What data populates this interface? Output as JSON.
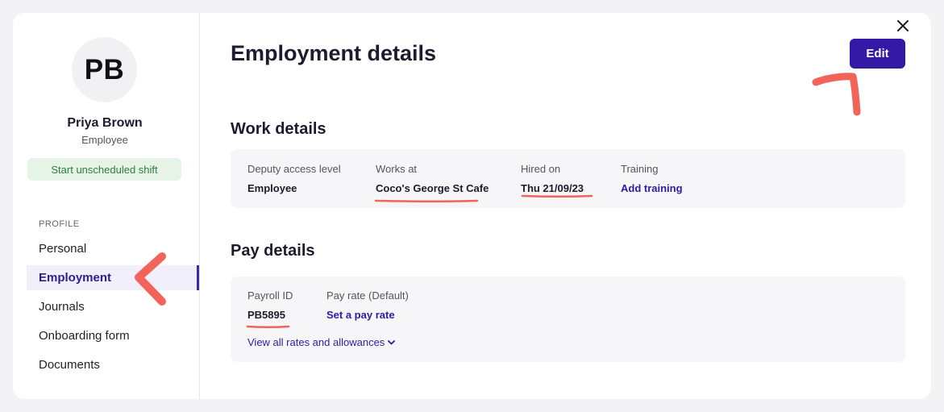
{
  "sidebar": {
    "avatar_initials": "PB",
    "name": "Priya Brown",
    "role": "Employee",
    "shift_button": "Start unscheduled shift",
    "section_label": "PROFILE",
    "items": [
      {
        "label": "Personal"
      },
      {
        "label": "Employment"
      },
      {
        "label": "Journals"
      },
      {
        "label": "Onboarding form"
      },
      {
        "label": "Documents"
      }
    ]
  },
  "main": {
    "title": "Employment details",
    "edit_button": "Edit",
    "work": {
      "heading": "Work details",
      "access_label": "Deputy access level",
      "access_value": "Employee",
      "works_at_label": "Works at",
      "works_at_value": "Coco's George St Cafe",
      "hired_label": "Hired on",
      "hired_value": "Thu 21/09/23",
      "training_label": "Training",
      "training_link": "Add training"
    },
    "pay": {
      "heading": "Pay details",
      "payroll_label": "Payroll ID",
      "payroll_value": "PB5895",
      "rate_label": "Pay rate (Default)",
      "rate_link": "Set a pay rate",
      "rates_link": "View all rates and allowances"
    }
  },
  "icons": {
    "close": "close-icon",
    "chevron": "chevron-down-icon"
  },
  "colors": {
    "accent": "#3219a6",
    "annotation": "#f2645a",
    "shift_bg": "#e6f4e8",
    "shift_text": "#2e7d3a"
  }
}
